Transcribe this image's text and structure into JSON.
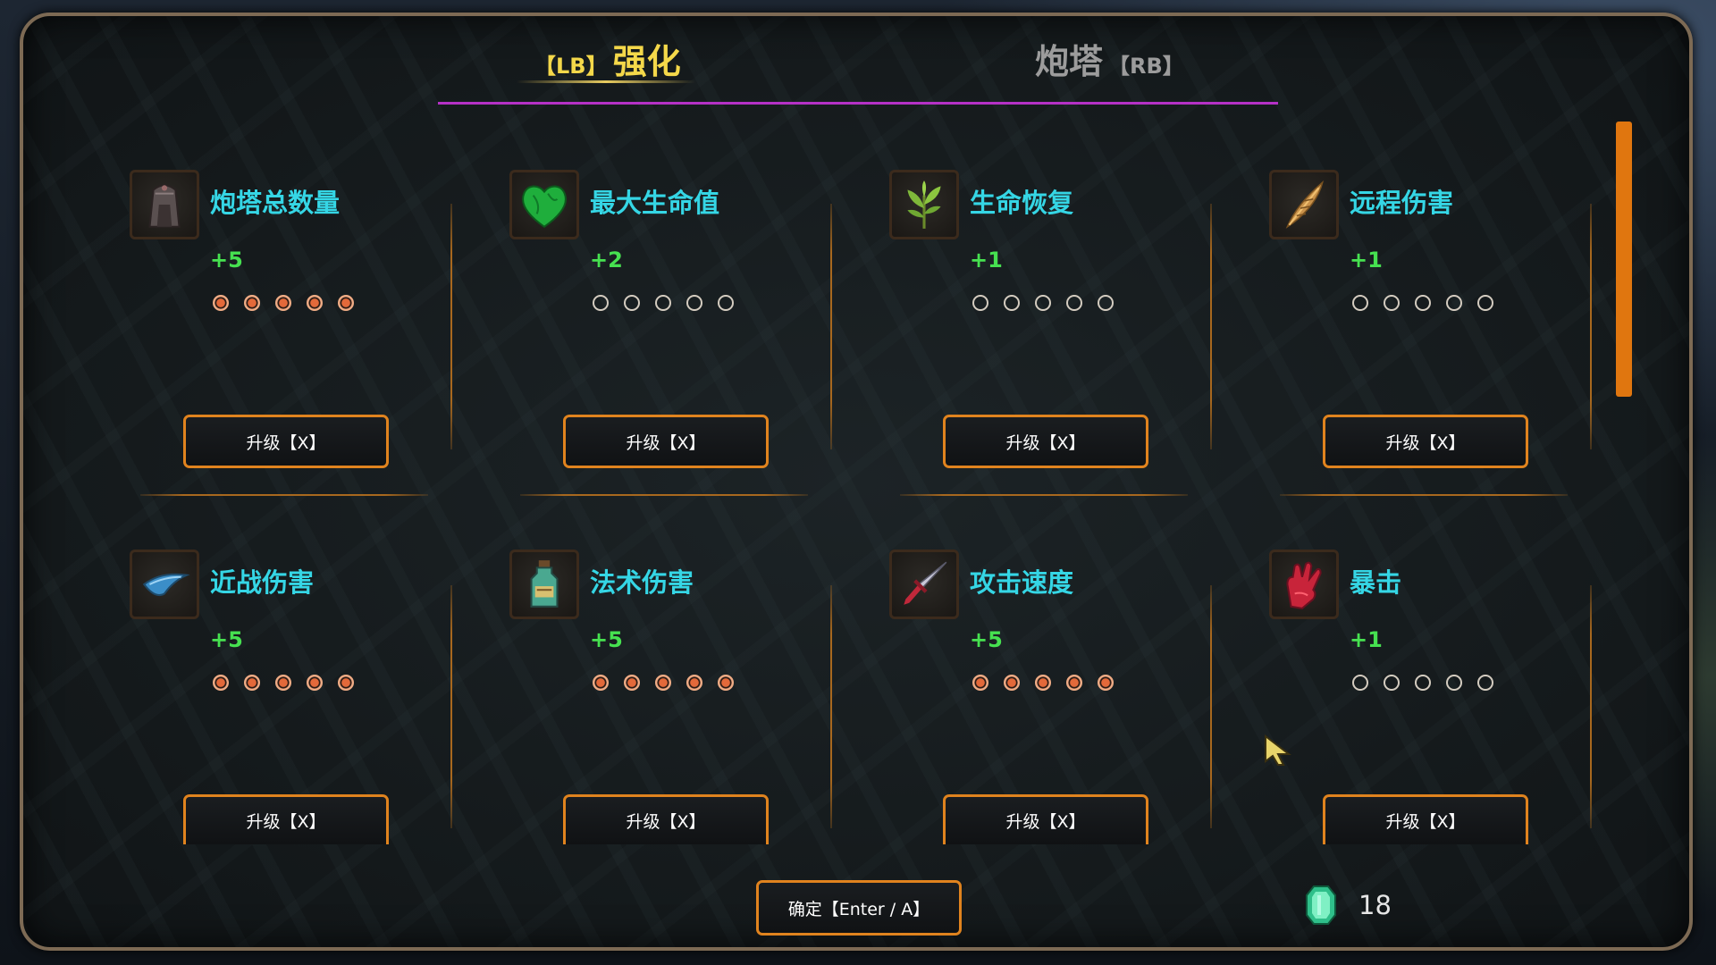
{
  "tabs": {
    "active": {
      "hint": "【LB】",
      "label": "强化"
    },
    "inactive": {
      "label": "炮塔",
      "hint": "【RB】"
    }
  },
  "cards": [
    {
      "title": "炮塔总数量",
      "bonus": "+5",
      "filled": 5,
      "total": 5,
      "icon": "tower-icon",
      "button": "升级【X】"
    },
    {
      "title": "最大生命值",
      "bonus": "+2",
      "filled": 0,
      "total": 5,
      "icon": "heart-icon",
      "button": "升级【X】"
    },
    {
      "title": "生命恢复",
      "bonus": "+1",
      "filled": 0,
      "total": 5,
      "icon": "herb-icon",
      "button": "升级【X】"
    },
    {
      "title": "远程伤害",
      "bonus": "+1",
      "filled": 0,
      "total": 5,
      "icon": "feather-icon",
      "button": "升级【X】"
    },
    {
      "title": "近战伤害",
      "bonus": "+5",
      "filled": 5,
      "total": 5,
      "icon": "blade-icon",
      "button": "升级【X】"
    },
    {
      "title": "法术伤害",
      "bonus": "+5",
      "filled": 5,
      "total": 5,
      "icon": "potion-icon",
      "button": "升级【X】"
    },
    {
      "title": "攻击速度",
      "bonus": "+5",
      "filled": 5,
      "total": 5,
      "icon": "dagger-icon",
      "button": "升级【X】"
    },
    {
      "title": "暴击",
      "bonus": "+1",
      "filled": 0,
      "total": 5,
      "icon": "glove-icon",
      "button": "升级【X】"
    }
  ],
  "footer": {
    "confirm": "确定【Enter / A】",
    "currency_icon": "gem-icon",
    "currency_count": "18"
  },
  "colors": {
    "title": "#35d6e5",
    "bonus": "#46e150",
    "active_tab": "#f4d84a",
    "tab_underline": "#b531c6",
    "button_border": "#e0831e",
    "pip_filled": "#e3693a"
  }
}
